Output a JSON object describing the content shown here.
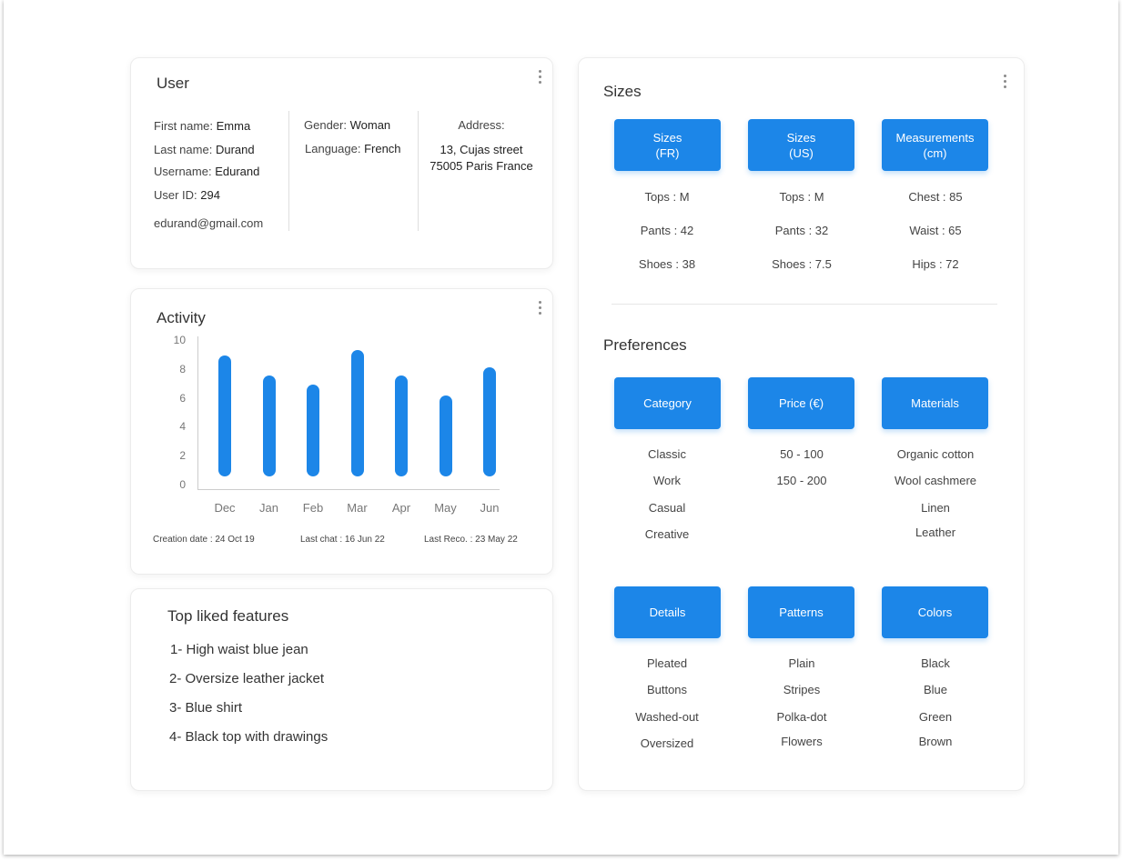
{
  "user_card": {
    "title": "User",
    "first_name_label": "First name:",
    "first_name": "Emma",
    "last_name_label": "Last name:",
    "last_name": "Durand",
    "username_label": "Username:",
    "username": "Edurand",
    "user_id_label": "User ID:",
    "user_id": "294",
    "email": "edurand@gmail.com",
    "gender_label": "Gender:",
    "gender": "Woman",
    "language_label": "Language:",
    "language": "French",
    "address_label": "Address:",
    "address_line1": "13, Cujas street",
    "address_line2": "75005 Paris France"
  },
  "activity_card": {
    "title": "Activity",
    "creation_date": "Creation date : 24 Oct 19",
    "last_chat": "Last chat : 16 Jun 22",
    "last_reco": "Last Reco. : 23 May 22"
  },
  "chart_data": {
    "type": "bar",
    "title": "",
    "categories": [
      "Dec",
      "Jan",
      "Feb",
      "Mar",
      "Apr",
      "May",
      "Jun"
    ],
    "values": [
      9,
      7.6,
      7,
      9.4,
      7.6,
      6.2,
      8.2
    ],
    "y_ticks": [
      "10",
      "8",
      "6",
      "4",
      "2",
      "0"
    ],
    "ylim": [
      0,
      10
    ],
    "grid": false,
    "bar_color": "#1c86e8"
  },
  "features_card": {
    "title": "Top liked features",
    "items": [
      "1- High waist blue jean",
      "2- Oversize leather jacket",
      "3- Blue shirt",
      "4- Black top with drawings"
    ]
  },
  "sizes_card": {
    "title": "Sizes",
    "buttons": [
      {
        "line1": "Sizes",
        "line2": "(FR)"
      },
      {
        "line1": "Sizes",
        "line2": "(US)"
      },
      {
        "line1": "Measurements",
        "line2": "(cm)"
      }
    ],
    "columns": [
      [
        "Tops : M",
        "Pants : 42",
        "Shoes : 38"
      ],
      [
        "Tops : M",
        "Pants : 32",
        "Shoes : 7.5"
      ],
      [
        "Chest : 85",
        "Waist : 65",
        "Hips : 72"
      ]
    ]
  },
  "preferences": {
    "title": "Preferences",
    "buttons": [
      "Category",
      "Price (€)",
      "Materials"
    ],
    "columns": [
      [
        "Classic",
        "Work",
        "Casual",
        "Creative"
      ],
      [
        "50 - 100",
        "150 - 200"
      ],
      [
        "Organic cotton",
        "Wool cashmere",
        "Linen",
        "Leather"
      ]
    ],
    "buttons2": [
      "Details",
      "Patterns",
      "Colors"
    ],
    "columns2": [
      [
        "Pleated",
        "Buttons",
        "Washed-out",
        "Oversized"
      ],
      [
        "Plain",
        "Stripes",
        "Polka-dot",
        "Flowers"
      ],
      [
        "Black",
        "Blue",
        "Green",
        "Brown"
      ]
    ]
  },
  "colors": {
    "accent": "#1c86e8"
  },
  "icons": {
    "menu": "kebab-menu-icon"
  }
}
